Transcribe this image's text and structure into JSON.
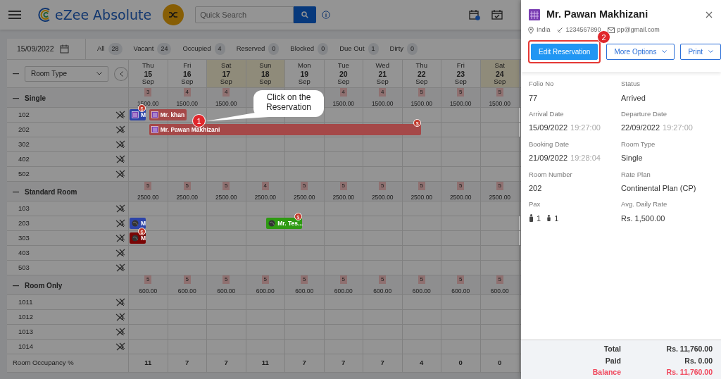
{
  "header": {
    "logo_text": "eZee Absolute",
    "search": {
      "placeholder": "Quick Search"
    }
  },
  "toolbar": {
    "date": "15/09/2022",
    "filters": [
      {
        "label": "All",
        "count": "28"
      },
      {
        "label": "Vacant",
        "count": "24"
      },
      {
        "label": "Occupied",
        "count": "4"
      },
      {
        "label": "Reserved",
        "count": "0"
      },
      {
        "label": "Blocked",
        "count": "0"
      },
      {
        "label": "Due Out",
        "count": "1"
      },
      {
        "label": "Dirty",
        "count": "0"
      }
    ]
  },
  "grid": {
    "room_type_select": "Room Type",
    "days": [
      {
        "weekday": "Thu",
        "day": "15",
        "month": "Sep",
        "weekend": false
      },
      {
        "weekday": "Fri",
        "day": "16",
        "month": "Sep",
        "weekend": false
      },
      {
        "weekday": "Sat",
        "day": "17",
        "month": "Sep",
        "weekend": true
      },
      {
        "weekday": "Sun",
        "day": "18",
        "month": "Sep",
        "weekend": true
      },
      {
        "weekday": "Mon",
        "day": "19",
        "month": "Sep",
        "weekend": false
      },
      {
        "weekday": "Tue",
        "day": "20",
        "month": "Sep",
        "weekend": false
      },
      {
        "weekday": "Wed",
        "day": "21",
        "month": "Sep",
        "weekend": false
      },
      {
        "weekday": "Thu",
        "day": "22",
        "month": "Sep",
        "weekend": false
      },
      {
        "weekday": "Fri",
        "day": "23",
        "month": "Sep",
        "weekend": false
      },
      {
        "weekday": "Sat",
        "day": "24",
        "month": "Sep",
        "weekend": true
      }
    ],
    "groups": [
      {
        "name": "Single",
        "cells": [
          {
            "availability": "3",
            "rate": "1500.00"
          },
          {
            "availability": "4",
            "rate": "1500.00"
          },
          {
            "availability": "4",
            "rate": "1500.00"
          },
          {
            "covered": true
          },
          {
            "covered": true
          },
          {
            "availability": "4",
            "rate": "1500.00"
          },
          {
            "availability": "4",
            "rate": "1500.00"
          },
          {
            "availability": "5",
            "rate": "1500.00"
          },
          {
            "availability": "5",
            "rate": "1500.00"
          },
          {
            "availability": "5",
            "rate": "1500.00"
          }
        ],
        "rooms": [
          {
            "number": "102",
            "reservations": [
              {
                "label": "M",
                "kind": "building",
                "color": "#2d44a8",
                "badge": "$"
              },
              {
                "label": "Mr. khan",
                "kind": "building",
                "color": "#a54848"
              }
            ]
          },
          {
            "number": "202",
            "reservations": [
              {
                "label": "Mr. Pawan Makhizani",
                "kind": "building",
                "color": "#a54848",
                "badge": "$"
              }
            ]
          },
          {
            "number": "302"
          },
          {
            "number": "402"
          },
          {
            "number": "502"
          }
        ]
      },
      {
        "name": "Standard Room",
        "cells": [
          {
            "availability": "5",
            "rate": "2500.00"
          },
          {
            "availability": "5",
            "rate": "2500.00"
          },
          {
            "availability": "5",
            "rate": "2500.00"
          },
          {
            "availability": "4",
            "rate": "2500.00"
          },
          {
            "availability": "5",
            "rate": "2500.00"
          },
          {
            "availability": "5",
            "rate": "2500.00"
          },
          {
            "availability": "5",
            "rate": "2500.00"
          },
          {
            "availability": "5",
            "rate": "2500.00"
          },
          {
            "availability": "5",
            "rate": "2500.00"
          },
          {
            "availability": "5",
            "rate": "2500.00"
          }
        ],
        "rooms": [
          {
            "number": "103"
          },
          {
            "number": "203",
            "reservations": [
              {
                "label": "M",
                "kind": "globe",
                "color": "#2d44a8"
              },
              {
                "label": "Mr. Tes...",
                "kind": "globe",
                "color": "#2e9a12",
                "badge": "$"
              }
            ]
          },
          {
            "number": "303",
            "reservations": [
              {
                "label": "M",
                "kind": "globe",
                "color": "#7a0505",
                "badge": "$"
              }
            ]
          },
          {
            "number": "403"
          },
          {
            "number": "503"
          }
        ]
      },
      {
        "name": "Room Only",
        "cells": [
          {
            "availability": "5",
            "rate": "600.00"
          },
          {
            "availability": "5",
            "rate": "600.00"
          },
          {
            "availability": "5",
            "rate": "600.00"
          },
          {
            "availability": "5",
            "rate": "600.00"
          },
          {
            "availability": "5",
            "rate": "600.00"
          },
          {
            "availability": "5",
            "rate": "600.00"
          },
          {
            "availability": "5",
            "rate": "600.00"
          },
          {
            "availability": "5",
            "rate": "600.00"
          },
          {
            "availability": "5",
            "rate": "600.00"
          },
          {
            "availability": "5",
            "rate": "600.00"
          }
        ],
        "rooms": [
          {
            "number": "1011"
          },
          {
            "number": "1012"
          },
          {
            "number": "1013"
          },
          {
            "number": "1014"
          }
        ]
      }
    ],
    "occupancy": {
      "label": "Room Occupancy %",
      "values": [
        "11",
        "7",
        "7",
        "11",
        "7",
        "7",
        "7",
        "4",
        "0",
        "0"
      ]
    }
  },
  "callout": {
    "step": "1",
    "text": "Click on the Reservation"
  },
  "reservation_panel": {
    "guest_name": "Mr. Pawan Makhizani",
    "country": "India",
    "phone": "1234567890",
    "email": "pp@gmail.com",
    "buttons": [
      {
        "label": "Edit Reservation",
        "kind": "primary",
        "dropdown": false,
        "highlighted": true,
        "step": "2"
      },
      {
        "label": "More Options",
        "kind": "outline",
        "dropdown": true,
        "highlighted": false
      },
      {
        "label": "Print",
        "kind": "outline",
        "dropdown": true,
        "highlighted": false
      }
    ],
    "fields": [
      {
        "label": "Folio No",
        "value": "77"
      },
      {
        "label": "Status",
        "value": "Arrived"
      },
      {
        "label": "Arrival Date",
        "value": "15/09/2022",
        "time": "19:27:00"
      },
      {
        "label": "Departure Date",
        "value": "22/09/2022",
        "time": "19:27:00"
      },
      {
        "label": "Booking Date",
        "value": "21/09/2022",
        "time": "19:28:04"
      },
      {
        "label": "Room Type",
        "value": "Single"
      },
      {
        "label": "Room Number",
        "value": "202"
      },
      {
        "label": "Rate Plan",
        "value": "Continental Plan (CP)"
      },
      {
        "label": "Pax",
        "kind": "pax",
        "adults": "1",
        "children": "1"
      },
      {
        "label": "Avg. Daily Rate",
        "value": "Rs. 1,500.00"
      }
    ],
    "totals": [
      {
        "label": "Total",
        "amount": "Rs. 11,760.00",
        "due": false
      },
      {
        "label": "Paid",
        "amount": "Rs. 0.00",
        "due": false
      },
      {
        "label": "Balance",
        "amount": "Rs. 11,760.00",
        "due": true
      }
    ]
  }
}
